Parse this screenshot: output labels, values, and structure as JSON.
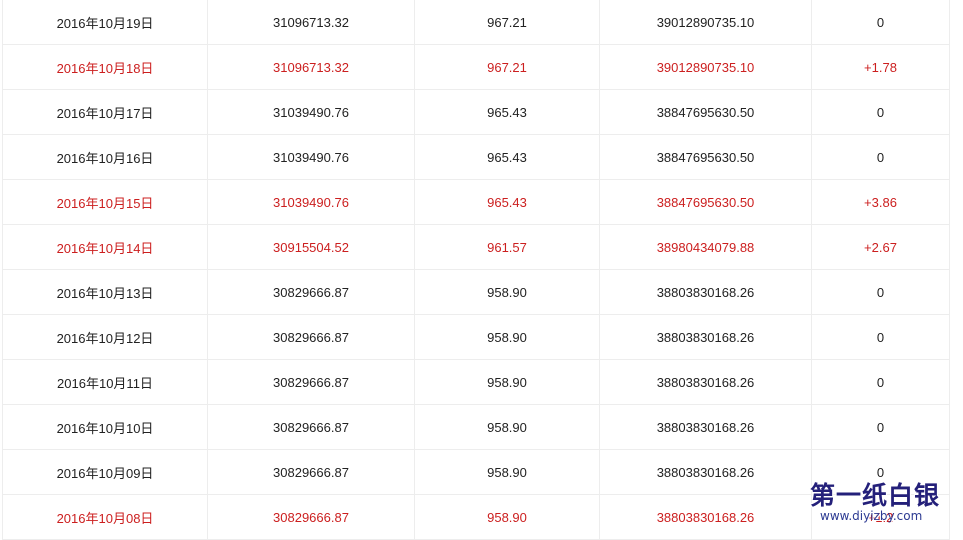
{
  "rows": [
    {
      "date": "2016年10月19日",
      "holdings_oz": "31096713.32",
      "holdings_t": "967.21",
      "value": "39012890735.10",
      "change": "0",
      "up": false
    },
    {
      "date": "2016年10月18日",
      "holdings_oz": "31096713.32",
      "holdings_t": "967.21",
      "value": "39012890735.10",
      "change": "+1.78",
      "up": true
    },
    {
      "date": "2016年10月17日",
      "holdings_oz": "31039490.76",
      "holdings_t": "965.43",
      "value": "38847695630.50",
      "change": "0",
      "up": false
    },
    {
      "date": "2016年10月16日",
      "holdings_oz": "31039490.76",
      "holdings_t": "965.43",
      "value": "38847695630.50",
      "change": "0",
      "up": false
    },
    {
      "date": "2016年10月15日",
      "holdings_oz": "31039490.76",
      "holdings_t": "965.43",
      "value": "38847695630.50",
      "change": "+3.86",
      "up": true
    },
    {
      "date": "2016年10月14日",
      "holdings_oz": "30915504.52",
      "holdings_t": "961.57",
      "value": "38980434079.88",
      "change": "+2.67",
      "up": true
    },
    {
      "date": "2016年10月13日",
      "holdings_oz": "30829666.87",
      "holdings_t": "958.90",
      "value": "38803830168.26",
      "change": "0",
      "up": false
    },
    {
      "date": "2016年10月12日",
      "holdings_oz": "30829666.87",
      "holdings_t": "958.90",
      "value": "38803830168.26",
      "change": "0",
      "up": false
    },
    {
      "date": "2016年10月11日",
      "holdings_oz": "30829666.87",
      "holdings_t": "958.90",
      "value": "38803830168.26",
      "change": "0",
      "up": false
    },
    {
      "date": "2016年10月10日",
      "holdings_oz": "30829666.87",
      "holdings_t": "958.90",
      "value": "38803830168.26",
      "change": "0",
      "up": false
    },
    {
      "date": "2016年10月09日",
      "holdings_oz": "30829666.87",
      "holdings_t": "958.90",
      "value": "38803830168.26",
      "change": "0",
      "up": false
    },
    {
      "date": "2016年10月08日",
      "holdings_oz": "30829666.87",
      "holdings_t": "958.90",
      "value": "38803830168.26",
      "change": "+1.2",
      "up": true
    }
  ],
  "watermark": {
    "title": "第一纸白银",
    "url": "www.diyizby.com"
  },
  "colors": {
    "up": "#cc1f1f",
    "normal": "#222222",
    "border": "#ededed",
    "watermark": "#24207a"
  }
}
